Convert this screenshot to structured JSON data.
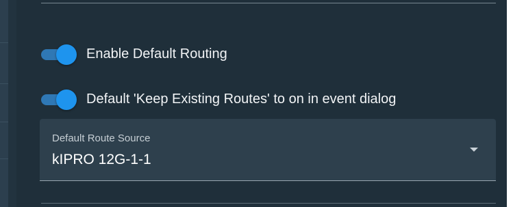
{
  "settings": {
    "enable_default_routing": {
      "label": "Enable Default Routing",
      "checked": true
    },
    "keep_existing_routes": {
      "label": "Default 'Keep Existing Routes' to on in event dialog",
      "checked": true
    },
    "default_route_source": {
      "label": "Default Route Source",
      "value": "kIPRO 12G-1-1"
    }
  },
  "colors": {
    "panel_bg": "#1f2f3a",
    "toggle_track": "#2f78b5",
    "toggle_thumb": "#1e94ee",
    "field_bg": "#2e404d",
    "text": "#f2f4f6"
  },
  "icons": {
    "dropdown": "chevron-down-icon"
  }
}
